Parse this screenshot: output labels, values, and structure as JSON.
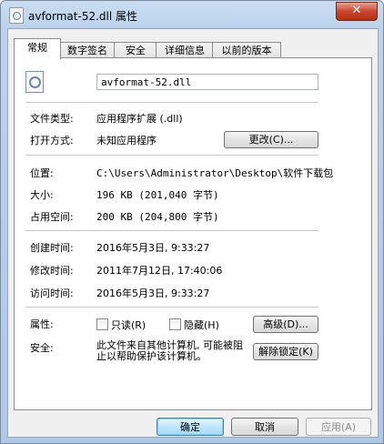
{
  "window": {
    "title": "avformat-52.dll 属性",
    "close_label": "✕"
  },
  "tabs": [
    "常规",
    "数字签名",
    "安全",
    "详细信息",
    "以前的版本"
  ],
  "file": {
    "name": "avformat-52.dll"
  },
  "details": {
    "type_label": "文件类型:",
    "type_value": "应用程序扩展 (.dll)",
    "open_label": "打开方式:",
    "open_value": "未知应用程序",
    "change_button": "更改(C)...",
    "location_label": "位置:",
    "location_value": "C:\\Users\\Administrator\\Desktop\\软件下载包",
    "size_label": "大小:",
    "size_value": "196 KB (201,040 字节)",
    "disk_label": "占用空间:",
    "disk_value": "200 KB (204,800 字节)",
    "created_label": "创建时间:",
    "created_value": "2016年5月3日, 9:33:27",
    "modified_label": "修改时间:",
    "modified_value": "2011年7月12日, 17:40:06",
    "accessed_label": "访问时间:",
    "accessed_value": "2016年5月3日, 9:33:27"
  },
  "attributes": {
    "label": "属性:",
    "readonly": "只读(R)",
    "hidden": "隐藏(H)",
    "advanced_button": "高级(D)..."
  },
  "security": {
    "label": "安全:",
    "text": "此文件来自其他计算机, 可能被阻止以帮助保护该计算机。",
    "unblock_button": "解除锁定(K)"
  },
  "buttons": {
    "ok": "确定",
    "cancel": "取消",
    "apply": "应用(A)"
  }
}
